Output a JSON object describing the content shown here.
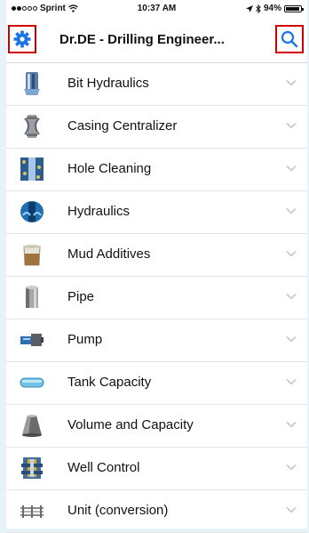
{
  "status_bar": {
    "carrier": "Sprint",
    "time": "10:37 AM",
    "battery": "94%",
    "battery_level": 0.94
  },
  "nav": {
    "title": "Dr.DE - Drilling Engineer...",
    "left_icon": "gear-icon",
    "right_icon": "search-icon",
    "accent_color": "#1a73e8",
    "highlight_color": "#d10000"
  },
  "items": [
    {
      "label": "Bit Hydraulics",
      "icon": "bit-hydraulics-icon"
    },
    {
      "label": "Casing Centralizer",
      "icon": "casing-centralizer-icon"
    },
    {
      "label": "Hole Cleaning",
      "icon": "hole-cleaning-icon"
    },
    {
      "label": "Hydraulics",
      "icon": "hydraulics-icon"
    },
    {
      "label": "Mud Additives",
      "icon": "mud-additives-icon"
    },
    {
      "label": "Pipe",
      "icon": "pipe-icon"
    },
    {
      "label": "Pump",
      "icon": "pump-icon"
    },
    {
      "label": "Tank Capacity",
      "icon": "tank-capacity-icon"
    },
    {
      "label": "Volume and Capacity",
      "icon": "volume-capacity-icon"
    },
    {
      "label": "Well Control",
      "icon": "well-control-icon"
    },
    {
      "label": "Unit (conversion)",
      "icon": "unit-conversion-icon"
    }
  ]
}
